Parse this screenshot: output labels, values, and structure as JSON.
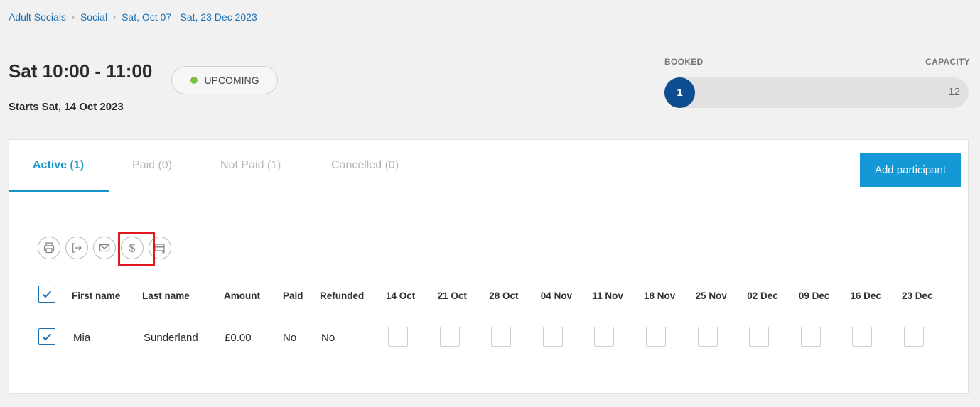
{
  "breadcrumb": [
    "Adult Socials",
    "Social",
    "Sat, Oct 07 - Sat, 23 Dec 2023"
  ],
  "session": {
    "title": "Sat 10:00 - 11:00",
    "starts": "Starts Sat, 14 Oct 2023",
    "status": "UPCOMING",
    "status_color": "#7cc242"
  },
  "capacity": {
    "booked_label": "BOOKED",
    "capacity_label": "CAPACITY",
    "booked": "1",
    "total": "12",
    "fill_color": "#0e4d8f"
  },
  "tabs": [
    {
      "label": "Active (1)",
      "active": true
    },
    {
      "label": "Paid (0)",
      "active": false
    },
    {
      "label": "Not Paid (1)",
      "active": false
    },
    {
      "label": "Cancelled (0)",
      "active": false
    }
  ],
  "add_participant_label": "Add participant",
  "toolbar_icons": [
    "print-icon",
    "export-icon",
    "email-icon",
    "dollar-icon",
    "add-payment-card-icon"
  ],
  "table": {
    "headers": [
      "First name",
      "Last name",
      "Amount",
      "Paid",
      "Refunded"
    ],
    "dates": [
      "14 Oct",
      "21 Oct",
      "28 Oct",
      "04 Nov",
      "11 Nov",
      "18 Nov",
      "25 Nov",
      "02 Dec",
      "09 Dec",
      "16 Dec",
      "23 Dec"
    ],
    "rows": [
      {
        "first_name": "Mia",
        "last_name": "Sunderland",
        "amount": "£0.00",
        "paid": "No",
        "refunded": "No",
        "selected": true
      }
    ]
  },
  "colors": {
    "accent": "#1995cd",
    "link": "#1a6fb3",
    "highlight": "#e0191f"
  }
}
